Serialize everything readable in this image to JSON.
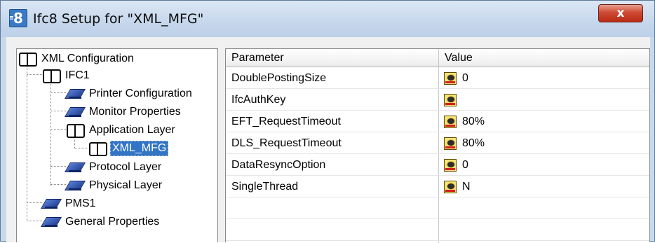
{
  "window": {
    "title": "Ifc8 Setup for \"XML_MFG\"",
    "icon": "app-icon-8",
    "close_glyph": "x"
  },
  "tree": {
    "items": [
      {
        "label": "XML Configuration",
        "icon": "book-icon"
      },
      {
        "label": "IFC1",
        "icon": "book-icon"
      },
      {
        "label": "Printer Configuration",
        "icon": "blue-book-icon"
      },
      {
        "label": "Monitor Properties",
        "icon": "blue-book-icon"
      },
      {
        "label": "Application Layer",
        "icon": "book-icon"
      },
      {
        "label": "XML_MFG",
        "icon": "book-icon",
        "selected": true
      },
      {
        "label": "Protocol Layer",
        "icon": "blue-book-icon"
      },
      {
        "label": "Physical Layer",
        "icon": "blue-book-icon"
      },
      {
        "label": "PMS1",
        "icon": "blue-book-icon"
      },
      {
        "label": "General Properties",
        "icon": "blue-book-icon"
      }
    ]
  },
  "grid": {
    "columns": [
      "Parameter",
      "Value"
    ],
    "rows": [
      {
        "parameter": "DoublePostingSize",
        "value": "0"
      },
      {
        "parameter": "IfcAuthKey",
        "value": ""
      },
      {
        "parameter": "EFT_RequestTimeout",
        "value": "80%"
      },
      {
        "parameter": "DLS_RequestTimeout",
        "value": "80%"
      },
      {
        "parameter": "DataResyncOption",
        "value": "0"
      },
      {
        "parameter": "SingleThread",
        "value": "N"
      }
    ]
  },
  "colors": {
    "selection": "#3274c5",
    "close_button": "#c9442e",
    "title_bar": "#c6d7ec"
  }
}
